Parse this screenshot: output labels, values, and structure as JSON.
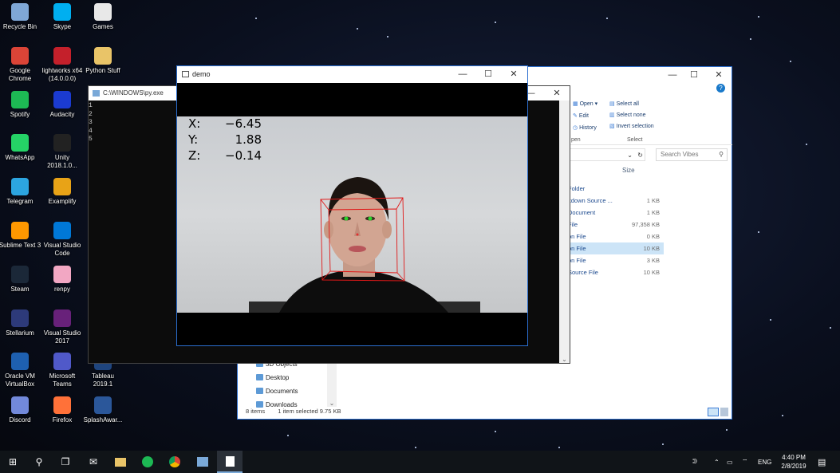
{
  "desktop": {
    "icons": [
      {
        "label": "Recycle Bin",
        "icon": "recycle-bin-icon",
        "color": "#7fa7d6"
      },
      {
        "label": "Skype",
        "icon": "skype-icon",
        "color": "#00aff0"
      },
      {
        "label": "Games",
        "icon": "games-icon",
        "color": "#e8e8e8"
      },
      {
        "label": "Google Chrome",
        "icon": "chrome-icon",
        "color": "#db4437"
      },
      {
        "label": "lightworks x64 (14.0.0.0)",
        "icon": "lightworks-icon",
        "color": "#c4202b"
      },
      {
        "label": "Python Stuff",
        "icon": "folder-icon",
        "color": "#e9c468"
      },
      {
        "label": "Spotify",
        "icon": "spotify-icon",
        "color": "#1db954"
      },
      {
        "label": "Audacity",
        "icon": "audacity-icon",
        "color": "#1b3bd1"
      },
      {
        "label": "WhatsApp",
        "icon": "whatsapp-icon",
        "color": "#25d366"
      },
      {
        "label": "Unity 2018.1.0...",
        "icon": "unity-icon",
        "color": "#222222"
      },
      {
        "label": "Telegram",
        "icon": "telegram-icon",
        "color": "#2ca5e0"
      },
      {
        "label": "Examplify",
        "icon": "examplify-icon",
        "color": "#e8a317"
      },
      {
        "label": "Sublime Text 3",
        "icon": "sublime-icon",
        "color": "#ff9800"
      },
      {
        "label": "Visual Studio Code",
        "icon": "vscode-icon",
        "color": "#0078d7"
      },
      {
        "label": "Steam",
        "icon": "steam-icon",
        "color": "#1b2838"
      },
      {
        "label": "renpy",
        "icon": "renpy-icon",
        "color": "#f2a7c3"
      },
      {
        "label": "Stellarium",
        "icon": "stellarium-icon",
        "color": "#2d3a7a"
      },
      {
        "label": "Visual Studio 2017",
        "icon": "visual-studio-icon",
        "color": "#68217a"
      },
      {
        "label": "Oracle VM VirtualBox",
        "icon": "virtualbox-icon",
        "color": "#1e60b0"
      },
      {
        "label": "Microsoft Teams",
        "icon": "teams-icon",
        "color": "#5059c9"
      },
      {
        "label": "Tableau 2019.1",
        "icon": "tableau-icon",
        "color": "#1f457e"
      },
      {
        "label": "Discord",
        "icon": "discord-icon",
        "color": "#7289da"
      },
      {
        "label": "Firefox",
        "icon": "firefox-icon",
        "color": "#ff7139"
      },
      {
        "label": "SplashAwar...",
        "icon": "word-icon",
        "color": "#2b579a"
      }
    ]
  },
  "explorer": {
    "ribbon": {
      "open": "Open ▾",
      "edit": "Edit",
      "history": "History",
      "select_all": "Select all",
      "select_none": "Select none",
      "invert_selection": "Invert selection",
      "group_open": "pen",
      "group_select": "Select"
    },
    "search_placeholder": "Search Vibes",
    "column_size": "Size",
    "files": [
      {
        "name": "Folder",
        "size": ""
      },
      {
        "name": "kdown Source ...",
        "size": "1 KB"
      },
      {
        "name": "Document",
        "size": "1 KB"
      },
      {
        "name": "File",
        "size": "97,358 KB"
      },
      {
        "name": "on File",
        "size": "0 KB"
      },
      {
        "name": "on File",
        "size": "10 KB"
      },
      {
        "name": "on File",
        "size": "3 KB"
      },
      {
        "name": "Source File",
        "size": "10 KB"
      }
    ],
    "nav": [
      "3D Objects",
      "Desktop",
      "Documents",
      "Downloads"
    ],
    "status_items": "8 items",
    "status_selected": "1 item selected  9.75 KB"
  },
  "console": {
    "title": "C:\\WINDOWS\\py.exe",
    "lines": [
      "1",
      "2",
      "3",
      "4",
      "5"
    ]
  },
  "demo": {
    "title": "demo",
    "x_label": "X:",
    "x_value": "−6.45",
    "y_label": "Y:",
    "y_value": "1.88",
    "z_label": "Z:",
    "z_value": "−0.14"
  },
  "taskbar": {
    "lang": "ENG",
    "time": "4:40 PM",
    "date": "2/8/2019"
  }
}
